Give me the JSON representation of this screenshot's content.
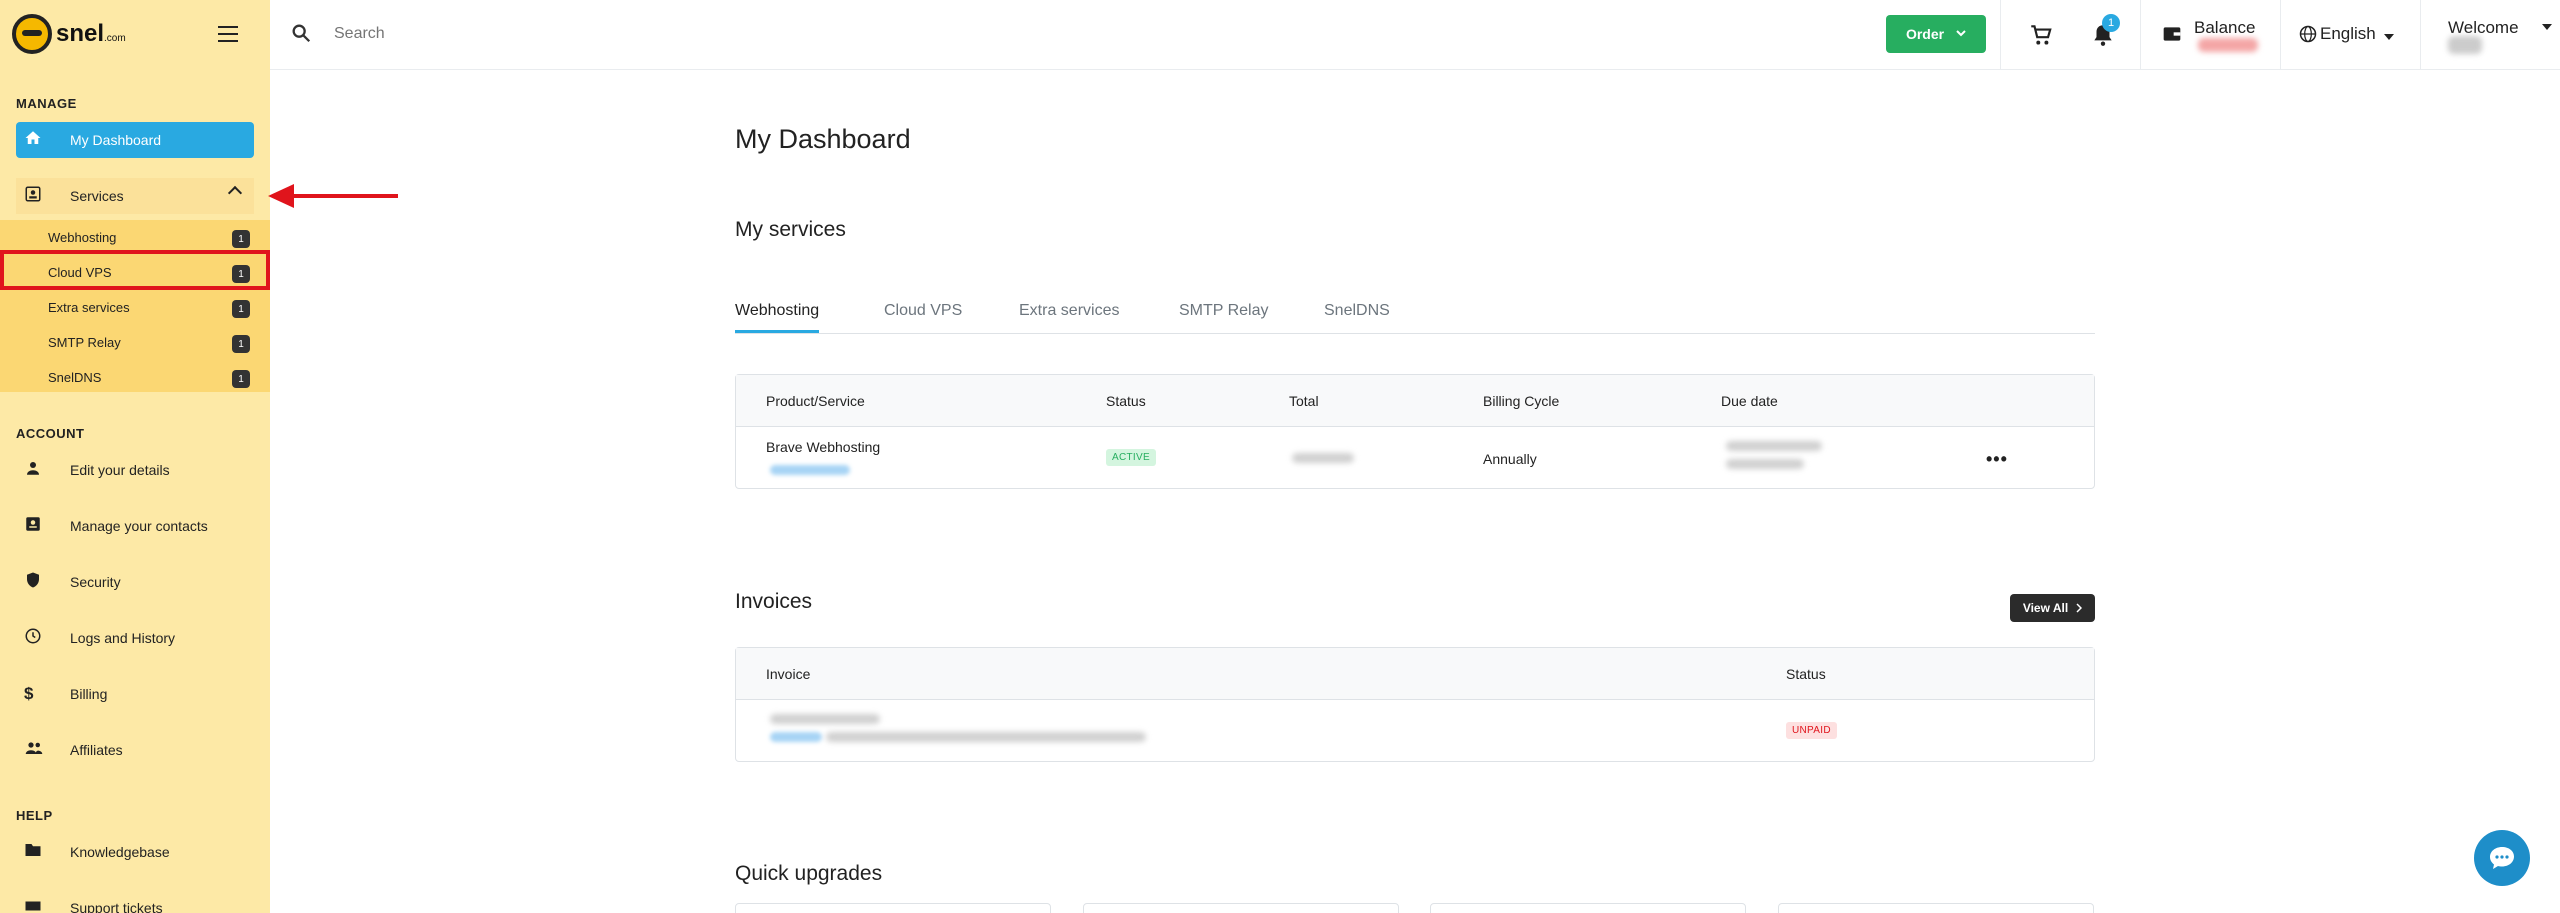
{
  "brand": {
    "name": "snel",
    "suffix": ".com"
  },
  "sidebar": {
    "manage_title": "MANAGE",
    "dashboard": "My Dashboard",
    "services": "Services",
    "sub_items": [
      {
        "label": "Webhosting",
        "count": "1"
      },
      {
        "label": "Cloud VPS",
        "count": "1"
      },
      {
        "label": "Extra services",
        "count": "1"
      },
      {
        "label": "SMTP Relay",
        "count": "1"
      },
      {
        "label": "SnelDNS",
        "count": "1"
      }
    ],
    "account_title": "ACCOUNT",
    "account_items": [
      "Edit your details",
      "Manage your contacts",
      "Security",
      "Logs and History",
      "Billing",
      "Affiliates"
    ],
    "help_title": "HELP",
    "help_items": [
      "Knowledgebase",
      "Support tickets"
    ]
  },
  "topbar": {
    "search_placeholder": "Search",
    "order_label": "Order",
    "notifications_count": "1",
    "balance_label": "Balance",
    "language_label": "English",
    "welcome_label": "Welcome"
  },
  "main": {
    "page_title": "My Dashboard",
    "services_title": "My services",
    "tabs": [
      "Webhosting",
      "Cloud VPS",
      "Extra services",
      "SMTP Relay",
      "SnelDNS"
    ],
    "services_table": {
      "headers": [
        "Product/Service",
        "Status",
        "Total",
        "Billing Cycle",
        "Due date"
      ],
      "rows": [
        {
          "product": "Brave Webhosting",
          "status": "ACTIVE",
          "billing_cycle": "Annually"
        }
      ]
    },
    "invoices_title": "Invoices",
    "view_all_label": "View All",
    "invoices_table": {
      "headers": [
        "Invoice",
        "Status"
      ],
      "rows": [
        {
          "status": "UNPAID"
        }
      ]
    },
    "quick_upgrades_title": "Quick upgrades"
  },
  "colors": {
    "accent": "#29a9e1",
    "order": "#27ae60",
    "highlight": "#e0141c",
    "sidebar": "#fde9a6"
  }
}
